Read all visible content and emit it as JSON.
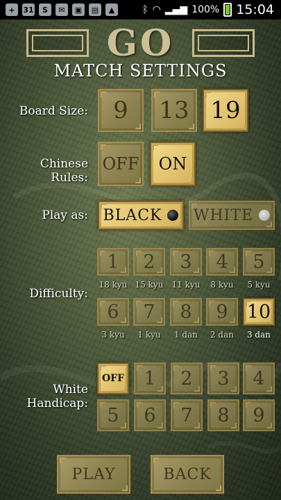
{
  "status_bar": {
    "notif_icons": [
      "+",
      "31",
      "S",
      "✉",
      "▣",
      "▤",
      "▲"
    ],
    "battery": "100%",
    "time": "15:04"
  },
  "header": {
    "title": "GO",
    "subtitle": "MATCH SETTINGS"
  },
  "board_size": {
    "label": "Board Size:",
    "options": [
      "9",
      "13",
      "19"
    ],
    "selected": "19"
  },
  "chinese_rules": {
    "label": "Chinese Rules:",
    "options": [
      "OFF",
      "ON"
    ],
    "selected": "ON"
  },
  "play_as": {
    "label": "Play as:",
    "options": [
      "BLACK",
      "WHITE"
    ],
    "selected": "BLACK"
  },
  "difficulty": {
    "label": "Difficulty:",
    "levels": [
      {
        "value": "1",
        "rank": "18 kyu"
      },
      {
        "value": "2",
        "rank": "15 kyu"
      },
      {
        "value": "3",
        "rank": "11 kyu"
      },
      {
        "value": "4",
        "rank": "8 kyu"
      },
      {
        "value": "5",
        "rank": "5 kyu"
      },
      {
        "value": "6",
        "rank": "3 kyu"
      },
      {
        "value": "7",
        "rank": "1 kyu"
      },
      {
        "value": "8",
        "rank": "1 dan"
      },
      {
        "value": "9",
        "rank": "2 dan"
      },
      {
        "value": "10",
        "rank": "3 dan"
      }
    ],
    "selected": "10"
  },
  "handicap": {
    "label_line1": "White",
    "label_line2": "Handicap:",
    "options": [
      "OFF",
      "1",
      "2",
      "3",
      "4",
      "5",
      "6",
      "7",
      "8",
      "9"
    ],
    "selected": "OFF"
  },
  "buttons": {
    "play": "PLAY",
    "back": "BACK"
  }
}
